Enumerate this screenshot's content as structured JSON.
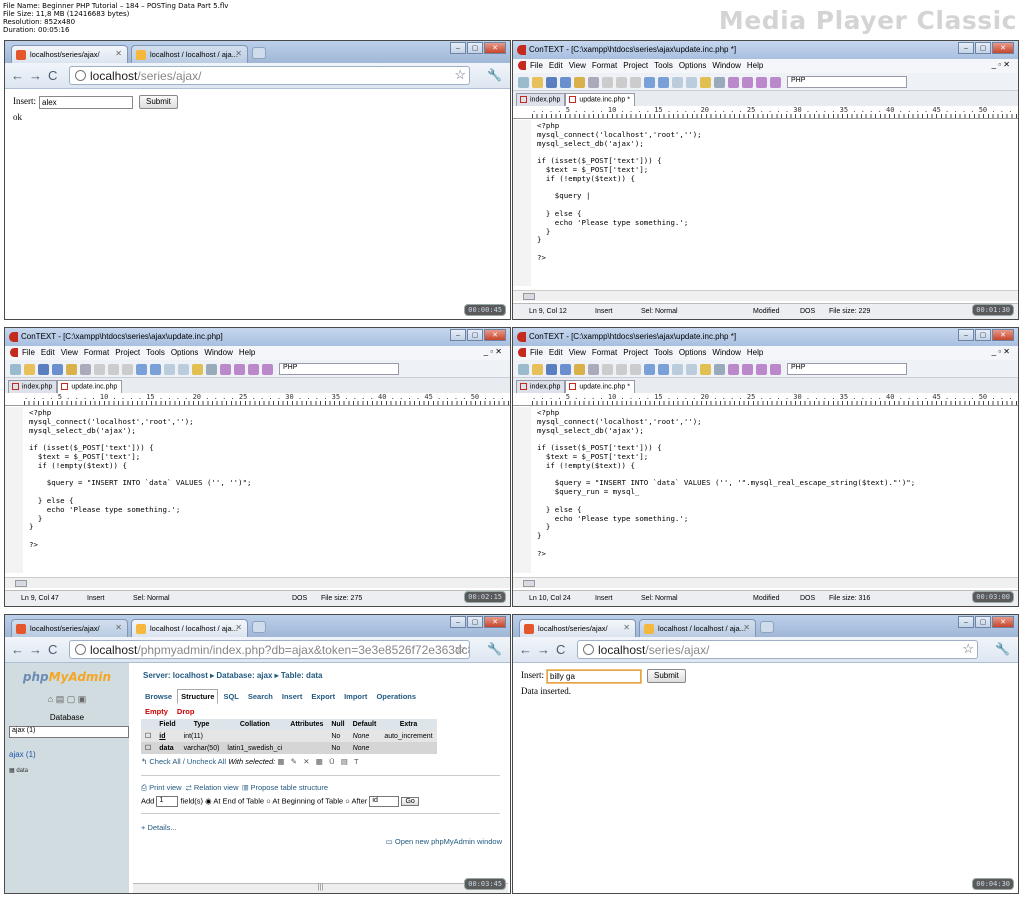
{
  "header": {
    "file_name": "File Name: Beginner PHP Tutorial – 184 – POSTing Data Part 5.flv",
    "file_size": "File Size: 11,8 MB (12416683 bytes)",
    "resolution": "Resolution: 852x480",
    "duration": "Duration: 00:05:16",
    "brand": "Media Player Classic"
  },
  "browser": {
    "tab1_label": "localhost/series/ajax/",
    "tab2_label": "localhost / localhost / aja...",
    "url_host": "localhost",
    "url_path": "/series/ajax/",
    "pma_url_path": "/phpmyadmin/index.php?db=ajax&token=3e3e8526f72e363dc865d0b22a301fc9"
  },
  "thumb1": {
    "timestamp": "00:00:45",
    "label": "Insert:",
    "input_value": "alex",
    "submit_label": "Submit",
    "result": "ok"
  },
  "thumb6": {
    "timestamp": "00:04:30",
    "label": "Insert:",
    "input_value": "billy ga",
    "submit_label": "Submit",
    "result": "Data inserted."
  },
  "editor": {
    "title_modified": "ConTEXT - [C:\\xampp\\htdocs\\series\\ajax\\update.inc.php *]",
    "title_saved": "ConTEXT - [C:\\xampp\\htdocs\\series\\ajax\\update.inc.php]",
    "menu": [
      "File",
      "Edit",
      "View",
      "Format",
      "Project",
      "Tools",
      "Options",
      "Window",
      "Help"
    ],
    "language": "PHP",
    "tab_index": "index.php",
    "tab_update_modified": "update.inc.php *",
    "tab_update_saved": "update.inc.php",
    "ruler": ". . . . 5 . . . . 10 . . . . 15 . . . . 20 . . . . 25 . . . . 30 . . . . 35 . . . . 40 . . . . 45 . . . . 50 . . . . 55 . . . . 60 . . . . 65 . . . . 70 . . . . 75 . . . . 80 . . . . 85 . . . . 90 . . . . 95 . . 10",
    "status_insert": "Insert",
    "status_sel": "Sel: Normal",
    "status_modified": "Modified",
    "status_dos": "DOS"
  },
  "thumb2": {
    "timestamp": "00:01:30",
    "pos": "Ln 9, Col 12",
    "filesize": "File size: 229",
    "lines": [
      "<?php",
      "mysql_connect('localhost','root','');",
      "mysql_select_db('ajax');",
      "",
      "if (isset($_POST['text'])) {",
      "  $text = $_POST['text'];",
      "  if (!empty($text)) {",
      "",
      "    $query |",
      "",
      "  } else {",
      "    echo 'Please type something.';",
      "  }",
      "}",
      "",
      "?>"
    ]
  },
  "thumb3": {
    "timestamp": "00:02:15",
    "pos": "Ln 9, Col 47",
    "filesize": "File size: 275",
    "lines": [
      "<?php",
      "mysql_connect('localhost','root','');",
      "mysql_select_db('ajax');",
      "",
      "if (isset($_POST['text'])) {",
      "  $text = $_POST['text'];",
      "  if (!empty($text)) {",
      "",
      "    $query = \"INSERT INTO `data` VALUES ('', '')\";",
      "",
      "  } else {",
      "    echo 'Please type something.';",
      "  }",
      "}",
      "",
      "?>"
    ]
  },
  "thumb4": {
    "timestamp": "00:03:00",
    "pos": "Ln 10, Col 24",
    "filesize": "File size: 316",
    "lines": [
      "<?php",
      "mysql_connect('localhost','root','');",
      "mysql_select_db('ajax');",
      "",
      "if (isset($_POST['text'])) {",
      "  $text = $_POST['text'];",
      "  if (!empty($text)) {",
      "",
      "    $query = \"INSERT INTO `data` VALUES ('', '\".mysql_real_escape_string($text).\"')\";",
      "    $query_run = mysql_",
      "",
      "  } else {",
      "    echo 'Please type something.';",
      "  }",
      "}",
      "",
      "?>"
    ]
  },
  "pma": {
    "timestamp": "00:03:45",
    "database_label": "Database",
    "db_select": "ajax (1)",
    "db_link": "ajax (1)",
    "table_link": "data",
    "crumb": "Server: localhost ▸ Database: ajax ▸ Table: data",
    "tabs": [
      "Browse",
      "Structure",
      "SQL",
      "Search",
      "Insert",
      "Export",
      "Import",
      "Operations",
      "Empty",
      "Drop"
    ],
    "columns": [
      "",
      "Field",
      "Type",
      "Collation",
      "Attributes",
      "Null",
      "Default",
      "Extra"
    ],
    "rows": [
      {
        "field": "id",
        "type": "int(11)",
        "collation": "",
        "attributes": "",
        "null": "No",
        "default": "None",
        "extra": "auto_increment"
      },
      {
        "field": "data",
        "type": "varchar(50)",
        "collation": "latin1_swedish_ci",
        "attributes": "",
        "null": "No",
        "default": "None",
        "extra": ""
      }
    ],
    "check_all": "Check All / Uncheck All",
    "with_selected": "With selected:",
    "print_view": "Print view",
    "relation_view": "Relation view",
    "propose": "Propose table structure",
    "add_label": "Add",
    "add_count": "1",
    "fields_label": "field(s)",
    "end_of_table": "At End of Table",
    "beginning": "At Beginning of Table",
    "after": "After",
    "after_field": "id",
    "go": "Go",
    "details": "+ Details...",
    "new_window": "Open new phpMyAdmin window"
  }
}
